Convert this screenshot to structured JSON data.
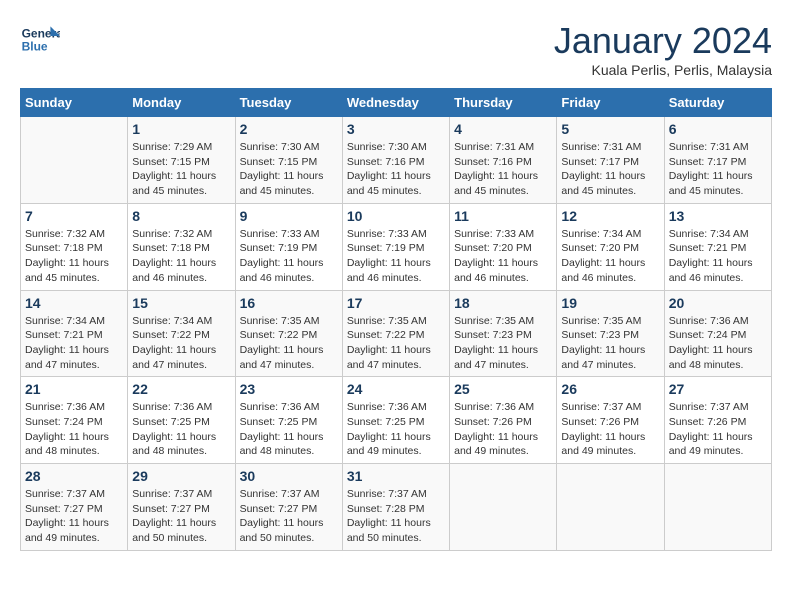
{
  "header": {
    "logo_line1": "General",
    "logo_line2": "Blue",
    "month": "January 2024",
    "location": "Kuala Perlis, Perlis, Malaysia"
  },
  "days_of_week": [
    "Sunday",
    "Monday",
    "Tuesday",
    "Wednesday",
    "Thursday",
    "Friday",
    "Saturday"
  ],
  "weeks": [
    [
      {
        "day": "",
        "text": ""
      },
      {
        "day": "1",
        "text": "Sunrise: 7:29 AM\nSunset: 7:15 PM\nDaylight: 11 hours and 45 minutes."
      },
      {
        "day": "2",
        "text": "Sunrise: 7:30 AM\nSunset: 7:15 PM\nDaylight: 11 hours and 45 minutes."
      },
      {
        "day": "3",
        "text": "Sunrise: 7:30 AM\nSunset: 7:16 PM\nDaylight: 11 hours and 45 minutes."
      },
      {
        "day": "4",
        "text": "Sunrise: 7:31 AM\nSunset: 7:16 PM\nDaylight: 11 hours and 45 minutes."
      },
      {
        "day": "5",
        "text": "Sunrise: 7:31 AM\nSunset: 7:17 PM\nDaylight: 11 hours and 45 minutes."
      },
      {
        "day": "6",
        "text": "Sunrise: 7:31 AM\nSunset: 7:17 PM\nDaylight: 11 hours and 45 minutes."
      }
    ],
    [
      {
        "day": "7",
        "text": "Sunrise: 7:32 AM\nSunset: 7:18 PM\nDaylight: 11 hours and 45 minutes."
      },
      {
        "day": "8",
        "text": "Sunrise: 7:32 AM\nSunset: 7:18 PM\nDaylight: 11 hours and 46 minutes."
      },
      {
        "day": "9",
        "text": "Sunrise: 7:33 AM\nSunset: 7:19 PM\nDaylight: 11 hours and 46 minutes."
      },
      {
        "day": "10",
        "text": "Sunrise: 7:33 AM\nSunset: 7:19 PM\nDaylight: 11 hours and 46 minutes."
      },
      {
        "day": "11",
        "text": "Sunrise: 7:33 AM\nSunset: 7:20 PM\nDaylight: 11 hours and 46 minutes."
      },
      {
        "day": "12",
        "text": "Sunrise: 7:34 AM\nSunset: 7:20 PM\nDaylight: 11 hours and 46 minutes."
      },
      {
        "day": "13",
        "text": "Sunrise: 7:34 AM\nSunset: 7:21 PM\nDaylight: 11 hours and 46 minutes."
      }
    ],
    [
      {
        "day": "14",
        "text": "Sunrise: 7:34 AM\nSunset: 7:21 PM\nDaylight: 11 hours and 47 minutes."
      },
      {
        "day": "15",
        "text": "Sunrise: 7:34 AM\nSunset: 7:22 PM\nDaylight: 11 hours and 47 minutes."
      },
      {
        "day": "16",
        "text": "Sunrise: 7:35 AM\nSunset: 7:22 PM\nDaylight: 11 hours and 47 minutes."
      },
      {
        "day": "17",
        "text": "Sunrise: 7:35 AM\nSunset: 7:22 PM\nDaylight: 11 hours and 47 minutes."
      },
      {
        "day": "18",
        "text": "Sunrise: 7:35 AM\nSunset: 7:23 PM\nDaylight: 11 hours and 47 minutes."
      },
      {
        "day": "19",
        "text": "Sunrise: 7:35 AM\nSunset: 7:23 PM\nDaylight: 11 hours and 47 minutes."
      },
      {
        "day": "20",
        "text": "Sunrise: 7:36 AM\nSunset: 7:24 PM\nDaylight: 11 hours and 48 minutes."
      }
    ],
    [
      {
        "day": "21",
        "text": "Sunrise: 7:36 AM\nSunset: 7:24 PM\nDaylight: 11 hours and 48 minutes."
      },
      {
        "day": "22",
        "text": "Sunrise: 7:36 AM\nSunset: 7:25 PM\nDaylight: 11 hours and 48 minutes."
      },
      {
        "day": "23",
        "text": "Sunrise: 7:36 AM\nSunset: 7:25 PM\nDaylight: 11 hours and 48 minutes."
      },
      {
        "day": "24",
        "text": "Sunrise: 7:36 AM\nSunset: 7:25 PM\nDaylight: 11 hours and 49 minutes."
      },
      {
        "day": "25",
        "text": "Sunrise: 7:36 AM\nSunset: 7:26 PM\nDaylight: 11 hours and 49 minutes."
      },
      {
        "day": "26",
        "text": "Sunrise: 7:37 AM\nSunset: 7:26 PM\nDaylight: 11 hours and 49 minutes."
      },
      {
        "day": "27",
        "text": "Sunrise: 7:37 AM\nSunset: 7:26 PM\nDaylight: 11 hours and 49 minutes."
      }
    ],
    [
      {
        "day": "28",
        "text": "Sunrise: 7:37 AM\nSunset: 7:27 PM\nDaylight: 11 hours and 49 minutes."
      },
      {
        "day": "29",
        "text": "Sunrise: 7:37 AM\nSunset: 7:27 PM\nDaylight: 11 hours and 50 minutes."
      },
      {
        "day": "30",
        "text": "Sunrise: 7:37 AM\nSunset: 7:27 PM\nDaylight: 11 hours and 50 minutes."
      },
      {
        "day": "31",
        "text": "Sunrise: 7:37 AM\nSunset: 7:28 PM\nDaylight: 11 hours and 50 minutes."
      },
      {
        "day": "",
        "text": ""
      },
      {
        "day": "",
        "text": ""
      },
      {
        "day": "",
        "text": ""
      }
    ]
  ]
}
